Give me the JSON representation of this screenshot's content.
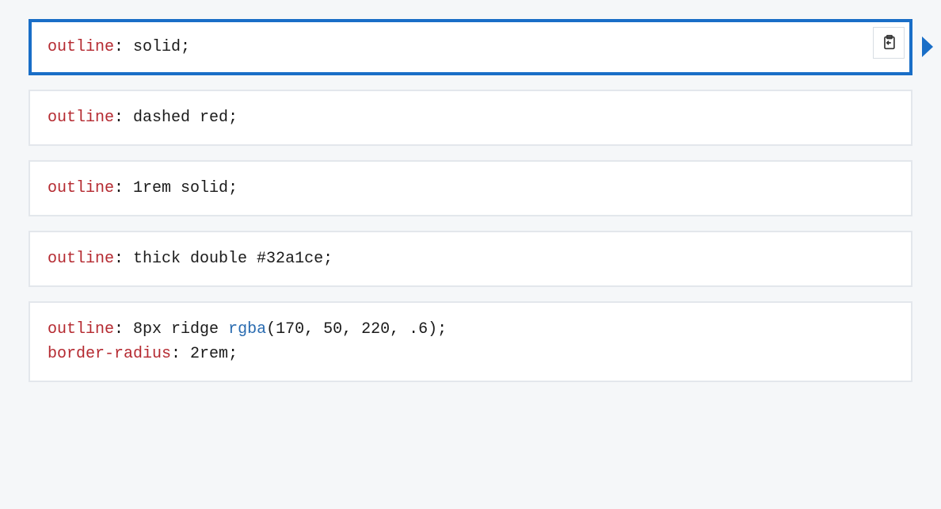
{
  "examples": [
    {
      "selected": true,
      "lines": [
        [
          {
            "cls": "tok-prop",
            "text": "outline"
          },
          {
            "cls": "tok-punc",
            "text": ": "
          },
          {
            "cls": "tok-val",
            "text": "solid"
          },
          {
            "cls": "tok-punc",
            "text": ";"
          }
        ]
      ]
    },
    {
      "selected": false,
      "lines": [
        [
          {
            "cls": "tok-prop",
            "text": "outline"
          },
          {
            "cls": "tok-punc",
            "text": ": "
          },
          {
            "cls": "tok-val",
            "text": "dashed red"
          },
          {
            "cls": "tok-punc",
            "text": ";"
          }
        ]
      ]
    },
    {
      "selected": false,
      "lines": [
        [
          {
            "cls": "tok-prop",
            "text": "outline"
          },
          {
            "cls": "tok-punc",
            "text": ": "
          },
          {
            "cls": "tok-val",
            "text": "1rem solid"
          },
          {
            "cls": "tok-punc",
            "text": ";"
          }
        ]
      ]
    },
    {
      "selected": false,
      "lines": [
        [
          {
            "cls": "tok-prop",
            "text": "outline"
          },
          {
            "cls": "tok-punc",
            "text": ": "
          },
          {
            "cls": "tok-val",
            "text": "thick double #32a1ce"
          },
          {
            "cls": "tok-punc",
            "text": ";"
          }
        ]
      ]
    },
    {
      "selected": false,
      "lines": [
        [
          {
            "cls": "tok-prop",
            "text": "outline"
          },
          {
            "cls": "tok-punc",
            "text": ": "
          },
          {
            "cls": "tok-val",
            "text": "8px ridge "
          },
          {
            "cls": "tok-func",
            "text": "rgba"
          },
          {
            "cls": "tok-punc",
            "text": "("
          },
          {
            "cls": "tok-val",
            "text": "170, 50, 220, .6"
          },
          {
            "cls": "tok-punc",
            "text": ")"
          },
          {
            "cls": "tok-punc",
            "text": ";"
          }
        ],
        [
          {
            "cls": "tok-prop",
            "text": "border-radius"
          },
          {
            "cls": "tok-punc",
            "text": ": "
          },
          {
            "cls": "tok-val",
            "text": "2rem"
          },
          {
            "cls": "tok-punc",
            "text": ";"
          }
        ]
      ]
    }
  ]
}
